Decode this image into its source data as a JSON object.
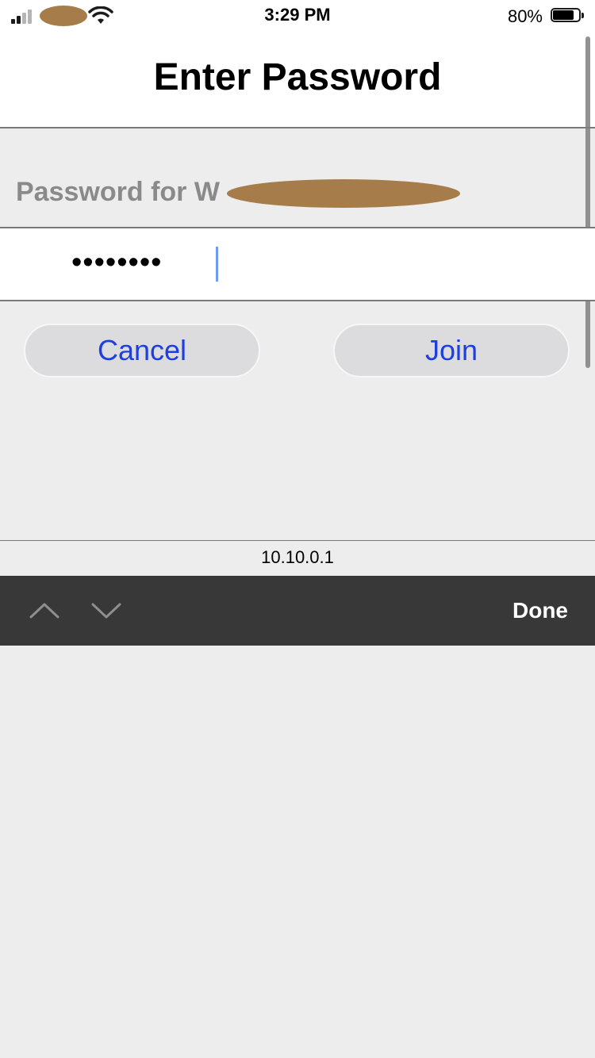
{
  "status_bar": {
    "time": "3:29 PM",
    "battery_percent": "80%",
    "battery_level": 0.8,
    "signal_bars_active": 2,
    "signal_bars_total": 4
  },
  "header": {
    "title": "Enter Password"
  },
  "prompt": {
    "label": "Password for W"
  },
  "password_field": {
    "masked_value": "••••••••"
  },
  "buttons": {
    "cancel": "Cancel",
    "join": "Join"
  },
  "footer": {
    "address": "10.10.0.1"
  },
  "toolbar": {
    "previous_icon": "chevron-up-icon",
    "next_icon": "chevron-down-icon",
    "done": "Done"
  },
  "colors": {
    "accent": "#1d3ee0",
    "toolbar_bg": "#383838",
    "background": "#ededed",
    "redaction": "#a67c4a"
  }
}
